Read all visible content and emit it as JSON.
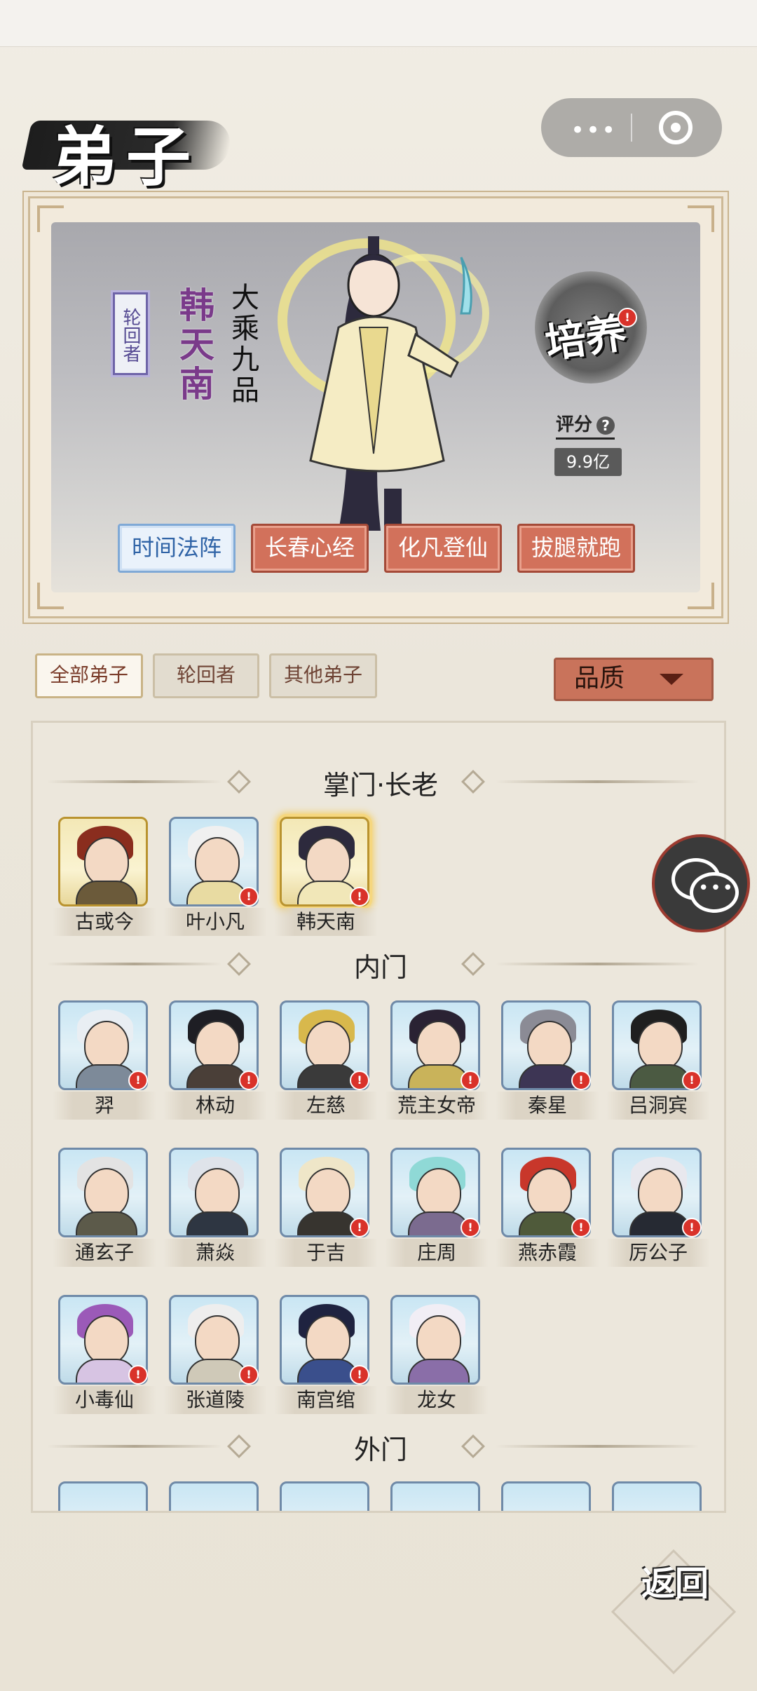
{
  "page": {
    "title": "弟子"
  },
  "hero": {
    "tag": "轮回者",
    "name": "韩天南",
    "rank": "大乘九品",
    "cultivate_label": "培养",
    "score_label": "评分",
    "score_help": "?",
    "score_value": "9.9亿",
    "skills": [
      {
        "label": "时间法阵",
        "state": "active"
      },
      {
        "label": "长春心经",
        "state": "locked"
      },
      {
        "label": "化凡登仙",
        "state": "locked"
      },
      {
        "label": "拔腿就跑",
        "state": "locked"
      }
    ]
  },
  "filters": {
    "tabs": [
      "全部弟子",
      "轮回者",
      "其他弟子"
    ],
    "selected": "全部弟子",
    "sort_label": "品质"
  },
  "roster": {
    "sections": [
      {
        "title": "掌门·长老",
        "members": [
          "古或今",
          "叶小凡",
          "韩天南"
        ]
      },
      {
        "title": "内门",
        "members": [
          "羿",
          "林动",
          "左慈",
          "荒主女帝",
          "秦星",
          "吕洞宾",
          "通玄子",
          "萧焱",
          "于吉",
          "庄周",
          "燕赤霞",
          "厉公子",
          "小毒仙",
          "张道陵",
          "南宫绾",
          "龙女"
        ]
      },
      {
        "title": "外门",
        "members": []
      }
    ]
  },
  "alert_mark": "!",
  "nav": {
    "back_label": "返回"
  },
  "colors": {
    "accent_red": "#c9735b",
    "active_blue": "#2f63a6",
    "purple_name": "#7a3a8a"
  }
}
